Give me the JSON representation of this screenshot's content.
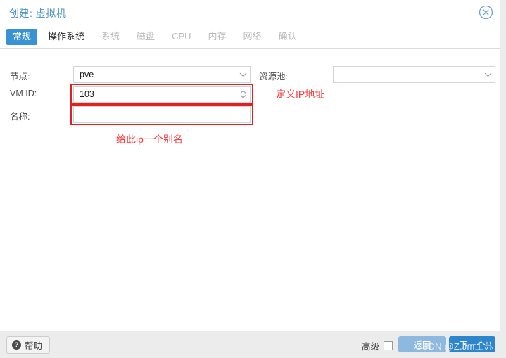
{
  "dialog": {
    "title": "创建: 虚拟机",
    "close_icon": "close-circle-icon"
  },
  "tabs": [
    {
      "label": "常规",
      "state": "active"
    },
    {
      "label": "操作系统",
      "state": "enabled"
    },
    {
      "label": "系统",
      "state": "disabled"
    },
    {
      "label": "磁盘",
      "state": "disabled"
    },
    {
      "label": "CPU",
      "state": "disabled"
    },
    {
      "label": "内存",
      "state": "disabled"
    },
    {
      "label": "网络",
      "state": "disabled"
    },
    {
      "label": "确认",
      "state": "disabled"
    }
  ],
  "form": {
    "node": {
      "label": "节点:",
      "value": "pve",
      "placeholder": "",
      "trigger_icon": "chevron-down-icon"
    },
    "vmid": {
      "label": "VM ID:",
      "value": "103",
      "placeholder": "",
      "trigger_icon": "spinner-up-down-icon"
    },
    "name": {
      "label": "名称:",
      "value": "",
      "placeholder": ""
    },
    "pool": {
      "label": "资源池:",
      "value": "",
      "placeholder": "",
      "trigger_icon": "chevron-down-icon"
    }
  },
  "annotations": {
    "color": "#fc3c3c",
    "box_color": "#e41f1f",
    "ip_note": "定义IP地址",
    "alias_note": "给此ip一个别名"
  },
  "footer": {
    "help_label": "帮助",
    "help_icon": "question-mark-icon",
    "advanced_label": "高级",
    "advanced_checked": false,
    "back_label": "返回",
    "next_label": "下一个",
    "watermark": "CSDN @Z.Jm土苏"
  },
  "colors": {
    "accent": "#3892d4",
    "title": "#4a90c4",
    "primary_button": "#2d86cc",
    "secondary_button": "#8cb9dd",
    "annotation_red": "#fc3c3c"
  }
}
